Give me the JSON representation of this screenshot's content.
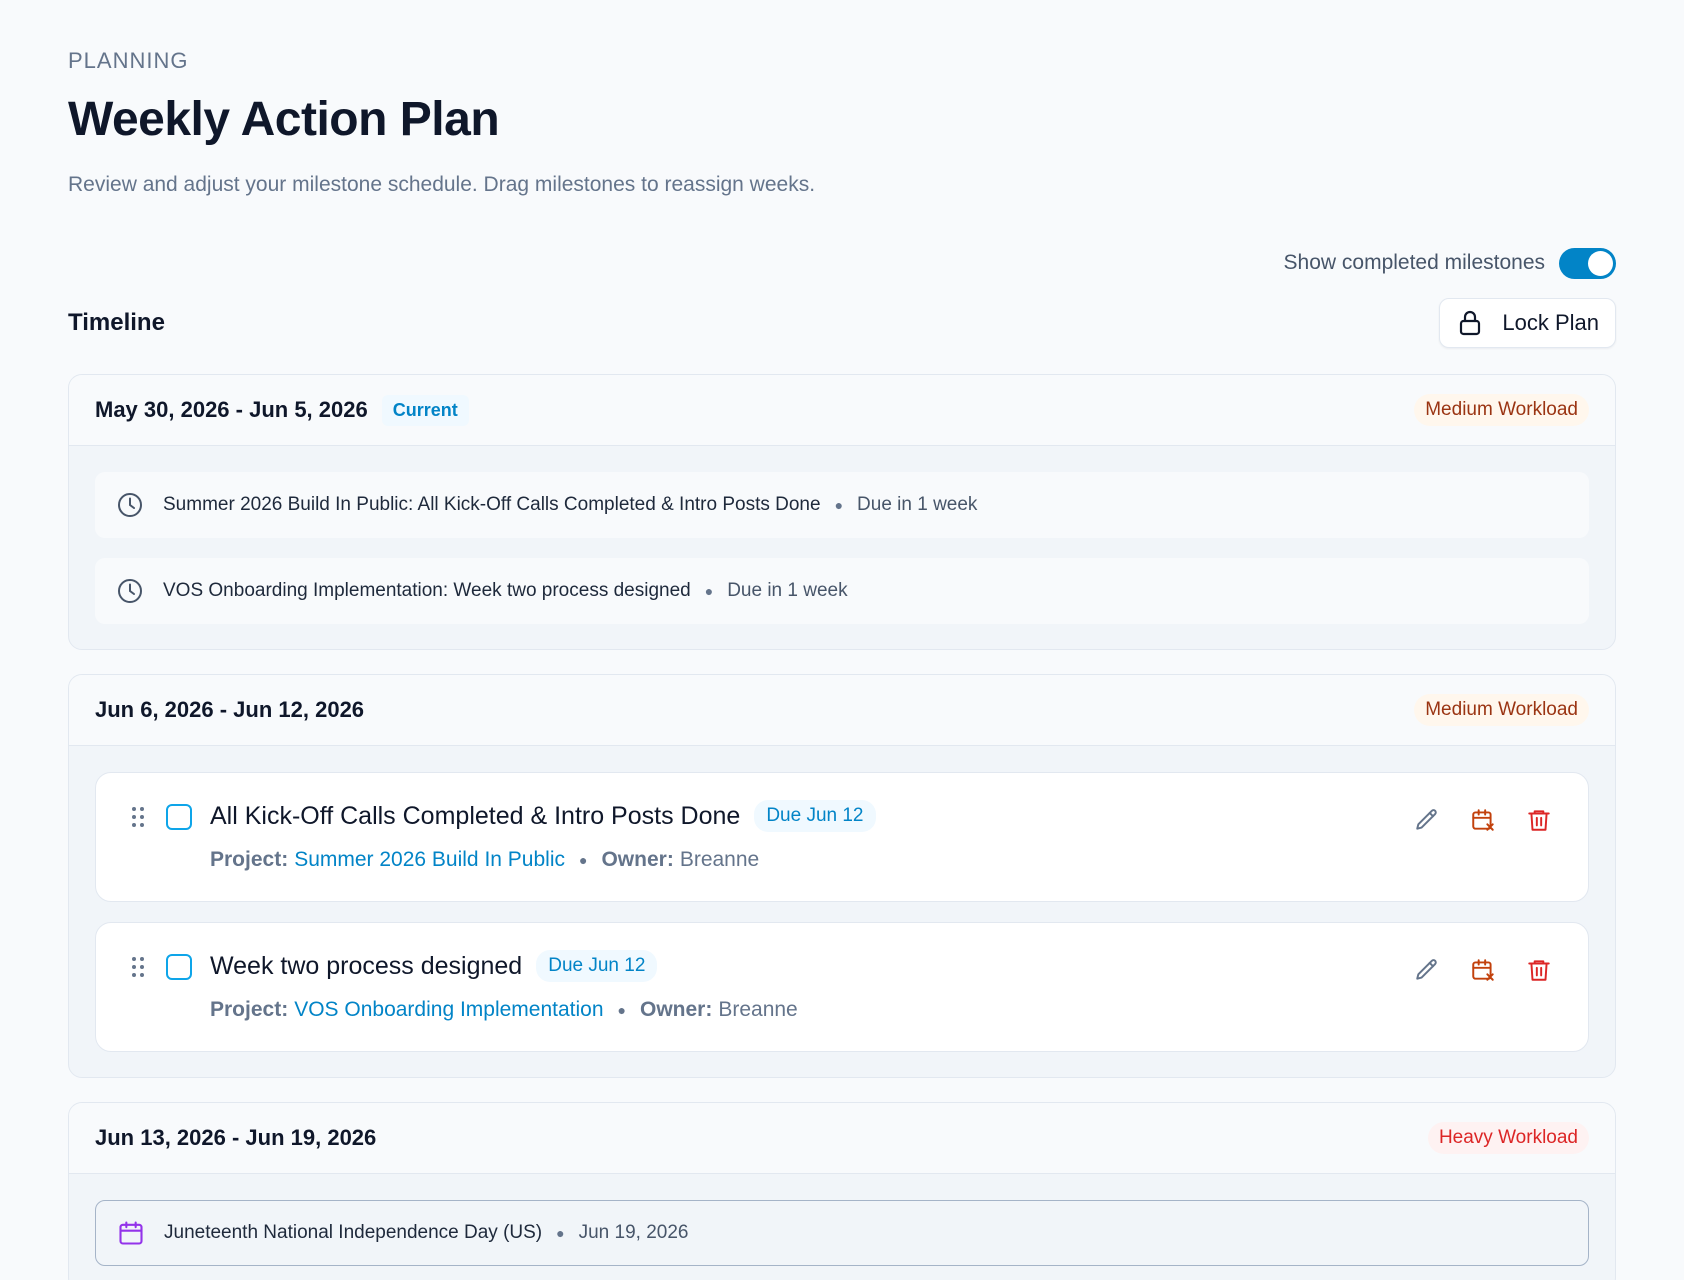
{
  "header": {
    "eyebrow": "PLANNING",
    "title": "Weekly Action Plan",
    "subtitle": "Review and adjust your milestone schedule. Drag milestones to reassign weeks."
  },
  "controls": {
    "toggle_label": "Show completed milestones",
    "toggle_on": true,
    "timeline_title": "Timeline",
    "lock_label": "Lock Plan"
  },
  "weeks": [
    {
      "range": "May 30, 2026 - Jun 5, 2026",
      "badge": "Current",
      "workload": "Medium Workload",
      "items": [
        {
          "text": "Summer 2026 Build In Public: All Kick-Off Calls Completed & Intro Posts Done",
          "due": "Due in 1 week"
        },
        {
          "text": "VOS Onboarding Implementation: Week two process designed",
          "due": "Due in 1 week"
        }
      ]
    },
    {
      "range": "Jun 6, 2026 - Jun 12, 2026",
      "workload": "Medium Workload",
      "cards": [
        {
          "title": "All Kick-Off Calls Completed & Intro Posts Done",
          "due": "Due Jun 12",
          "project_key": "Project:",
          "project": "Summer 2026 Build In Public",
          "owner_key": "Owner:",
          "owner": "Breanne"
        },
        {
          "title": "Week two process designed",
          "due": "Due Jun 12",
          "project_key": "Project:",
          "project": "VOS Onboarding Implementation",
          "owner_key": "Owner:",
          "owner": "Breanne"
        }
      ]
    },
    {
      "range": "Jun 13, 2026 - Jun 19, 2026",
      "workload": "Heavy Workload",
      "holidays": [
        {
          "text": "Juneteenth National Independence Day (US)",
          "date": "Jun 19, 2026"
        }
      ]
    }
  ],
  "colors": {
    "accent": "#0284c7",
    "medium_workload": "#9a3412",
    "heavy_workload": "#dc2626",
    "holiday_icon": "#9333ea"
  }
}
